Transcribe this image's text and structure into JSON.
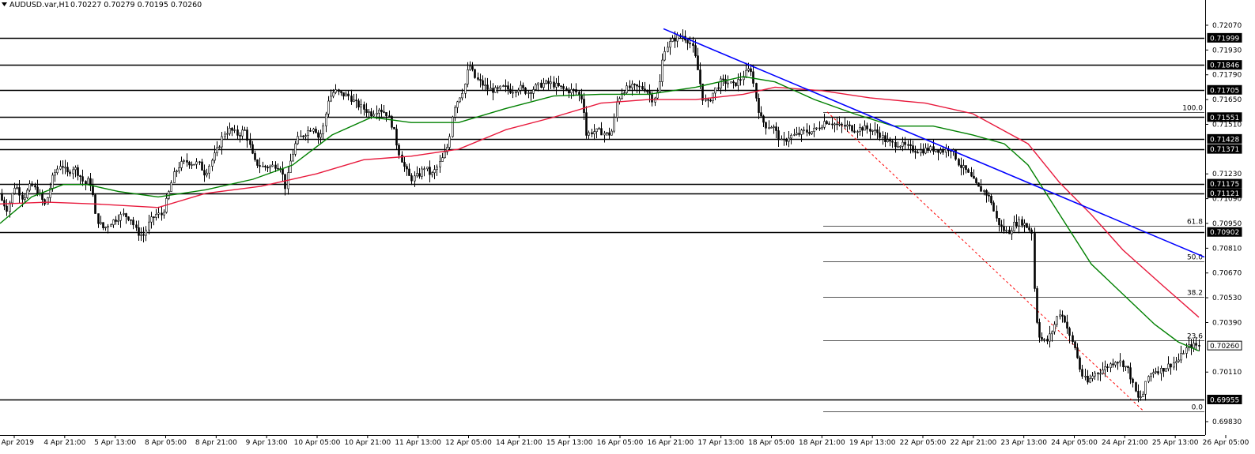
{
  "header": {
    "symbol_text": "AUDUSD.var,H1",
    "ohlc_text": "0.70227 0.70279 0.70195 0.70260"
  },
  "colors": {
    "background": "#ffffff",
    "axis": "#000000",
    "candle_bull": "#ffffff",
    "candle_bear": "#000000",
    "ma_fast": "#008000",
    "ma_slow": "#e8193c",
    "trendline": "#0000ff",
    "fib_level": "#555555",
    "fib_diagonal": "#ff0000",
    "sr_line": "#000000"
  },
  "chart_data": {
    "type": "candlestick",
    "y_range": [
      0.6983,
      0.7211
    ],
    "price_ticks": [
      "0.72070",
      "0.71930",
      "0.71790",
      "0.71650",
      "0.71510",
      "0.71230",
      "0.71090",
      "0.70950",
      "0.70810",
      "0.70670",
      "0.70530",
      "0.70390",
      "0.70110",
      "0.69830"
    ],
    "highlighted_prices": [
      "0.71999",
      "0.71846",
      "0.71705",
      "0.71551",
      "0.71428",
      "0.71371",
      "0.71175",
      "0.71121",
      "0.70902",
      "0.70260",
      "0.69955"
    ],
    "current_price": "0.70260",
    "time_ticks": [
      "4 Apr 2019",
      "4 Apr 21:00",
      "5 Apr 13:00",
      "8 Apr 05:00",
      "8 Apr 21:00",
      "9 Apr 13:00",
      "10 Apr 05:00",
      "10 Apr 21:00",
      "11 Apr 13:00",
      "12 Apr 05:00",
      "14 Apr 21:00",
      "15 Apr 13:00",
      "16 Apr 05:00",
      "16 Apr 21:00",
      "17 Apr 13:00",
      "18 Apr 05:00",
      "18 Apr 21:00",
      "19 Apr 13:00",
      "22 Apr 05:00",
      "22 Apr 21:00",
      "23 Apr 13:00",
      "24 Apr 05:00",
      "24 Apr 21:00",
      "25 Apr 13:00",
      "26 Apr 05:00"
    ],
    "support_resistance": [
      0.71999,
      0.71846,
      0.71705,
      0.71551,
      0.71428,
      0.71371,
      0.71175,
      0.71121,
      0.70902,
      0.69955
    ],
    "fibonacci": {
      "high": 0.7158,
      "low": 0.6989,
      "levels": [
        {
          "label": "100.0",
          "ratio": 1.0
        },
        {
          "label": "61.8",
          "ratio": 0.618
        },
        {
          "label": "50.0",
          "ratio": 0.5
        },
        {
          "label": "38.2",
          "ratio": 0.382
        },
        {
          "label": "23.6",
          "ratio": 0.236
        },
        {
          "label": "0.0",
          "ratio": 0.0
        }
      ]
    },
    "trendline": {
      "from": 0.7205,
      "to": 0.7076
    },
    "price_path": [
      [
        0,
        0.7112
      ],
      [
        12,
        0.7103
      ],
      [
        22,
        0.7117
      ],
      [
        32,
        0.7109
      ],
      [
        42,
        0.7117
      ],
      [
        52,
        0.7112
      ],
      [
        60,
        0.7105
      ],
      [
        70,
        0.7122
      ],
      [
        80,
        0.7129
      ],
      [
        88,
        0.7123
      ],
      [
        96,
        0.7127
      ],
      [
        104,
        0.7122
      ],
      [
        110,
        0.7117
      ],
      [
        116,
        0.712
      ],
      [
        120,
        0.7112
      ],
      [
        124,
        0.7098
      ],
      [
        134,
        0.7092
      ],
      [
        144,
        0.7096
      ],
      [
        158,
        0.71
      ],
      [
        168,
        0.7098
      ],
      [
        176,
        0.709
      ],
      [
        184,
        0.7088
      ],
      [
        192,
        0.7096
      ],
      [
        200,
        0.71
      ],
      [
        208,
        0.71
      ],
      [
        215,
        0.711
      ],
      [
        222,
        0.7122
      ],
      [
        230,
        0.7128
      ],
      [
        238,
        0.713
      ],
      [
        246,
        0.7129
      ],
      [
        254,
        0.7129
      ],
      [
        262,
        0.7123
      ],
      [
        270,
        0.713
      ],
      [
        278,
        0.7137
      ],
      [
        286,
        0.7146
      ],
      [
        294,
        0.7148
      ],
      [
        304,
        0.7145
      ],
      [
        312,
        0.7148
      ],
      [
        318,
        0.714
      ],
      [
        324,
        0.713
      ],
      [
        334,
        0.7127
      ],
      [
        344,
        0.7127
      ],
      [
        352,
        0.7128
      ],
      [
        358,
        0.7127
      ],
      [
        364,
        0.7115
      ],
      [
        370,
        0.713
      ],
      [
        378,
        0.7142
      ],
      [
        386,
        0.7145
      ],
      [
        394,
        0.7148
      ],
      [
        400,
        0.715
      ],
      [
        406,
        0.7143
      ],
      [
        412,
        0.715
      ],
      [
        418,
        0.7165
      ],
      [
        426,
        0.717
      ],
      [
        434,
        0.7168
      ],
      [
        444,
        0.7167
      ],
      [
        452,
        0.7163
      ],
      [
        462,
        0.716
      ],
      [
        472,
        0.7157
      ],
      [
        482,
        0.716
      ],
      [
        492,
        0.7157
      ],
      [
        500,
        0.7149
      ],
      [
        506,
        0.7137
      ],
      [
        514,
        0.7127
      ],
      [
        522,
        0.712
      ],
      [
        532,
        0.7122
      ],
      [
        540,
        0.7127
      ],
      [
        548,
        0.7122
      ],
      [
        556,
        0.7127
      ],
      [
        564,
        0.7133
      ],
      [
        570,
        0.714
      ],
      [
        576,
        0.716
      ],
      [
        582,
        0.7165
      ],
      [
        590,
        0.7172
      ],
      [
        596,
        0.7185
      ],
      [
        604,
        0.7177
      ],
      [
        612,
        0.7174
      ],
      [
        620,
        0.7171
      ],
      [
        630,
        0.717
      ],
      [
        640,
        0.7172
      ],
      [
        650,
        0.717
      ],
      [
        660,
        0.7172
      ],
      [
        670,
        0.7169
      ],
      [
        680,
        0.7172
      ],
      [
        690,
        0.7174
      ],
      [
        700,
        0.7174
      ],
      [
        710,
        0.7172
      ],
      [
        720,
        0.717
      ],
      [
        730,
        0.717
      ],
      [
        740,
        0.7165
      ],
      [
        744,
        0.7145
      ],
      [
        752,
        0.7147
      ],
      [
        762,
        0.7147
      ],
      [
        772,
        0.7145
      ],
      [
        778,
        0.7148
      ],
      [
        782,
        0.7163
      ],
      [
        790,
        0.717
      ],
      [
        800,
        0.7172
      ],
      [
        810,
        0.7172
      ],
      [
        820,
        0.7171
      ],
      [
        828,
        0.7165
      ],
      [
        836,
        0.717
      ],
      [
        842,
        0.7193
      ],
      [
        850,
        0.7197
      ],
      [
        858,
        0.72
      ],
      [
        866,
        0.7201
      ],
      [
        874,
        0.7198
      ],
      [
        880,
        0.7193
      ],
      [
        886,
        0.718
      ],
      [
        892,
        0.7165
      ],
      [
        898,
        0.7163
      ],
      [
        906,
        0.717
      ],
      [
        914,
        0.7175
      ],
      [
        922,
        0.7175
      ],
      [
        930,
        0.7173
      ],
      [
        938,
        0.7176
      ],
      [
        946,
        0.718
      ],
      [
        952,
        0.7183
      ],
      [
        958,
        0.7168
      ],
      [
        964,
        0.7155
      ],
      [
        972,
        0.715
      ],
      [
        980,
        0.715
      ],
      [
        986,
        0.7145
      ],
      [
        992,
        0.714
      ],
      [
        1000,
        0.7144
      ],
      [
        1010,
        0.7145
      ],
      [
        1020,
        0.7147
      ],
      [
        1030,
        0.7147
      ],
      [
        1040,
        0.715
      ],
      [
        1046,
        0.7153
      ],
      [
        1054,
        0.7152
      ],
      [
        1064,
        0.715
      ],
      [
        1074,
        0.715
      ],
      [
        1084,
        0.7148
      ],
      [
        1094,
        0.7149
      ],
      [
        1104,
        0.7148
      ],
      [
        1114,
        0.7146
      ],
      [
        1122,
        0.7142
      ],
      [
        1130,
        0.714
      ],
      [
        1138,
        0.714
      ],
      [
        1146,
        0.7139
      ],
      [
        1156,
        0.7137
      ],
      [
        1166,
        0.7136
      ],
      [
        1176,
        0.7137
      ],
      [
        1186,
        0.7137
      ],
      [
        1196,
        0.7136
      ],
      [
        1204,
        0.7138
      ],
      [
        1210,
        0.7134
      ],
      [
        1216,
        0.7128
      ],
      [
        1224,
        0.7125
      ],
      [
        1232,
        0.712
      ],
      [
        1240,
        0.7115
      ],
      [
        1248,
        0.7113
      ],
      [
        1256,
        0.7108
      ],
      [
        1262,
        0.7098
      ],
      [
        1270,
        0.7092
      ],
      [
        1278,
        0.709
      ],
      [
        1286,
        0.7095
      ],
      [
        1294,
        0.7096
      ],
      [
        1302,
        0.7093
      ],
      [
        1308,
        0.709
      ],
      [
        1312,
        0.7045
      ],
      [
        1318,
        0.703
      ],
      [
        1326,
        0.7028
      ],
      [
        1334,
        0.7035
      ],
      [
        1342,
        0.7045
      ],
      [
        1350,
        0.704
      ],
      [
        1356,
        0.703
      ],
      [
        1362,
        0.7025
      ],
      [
        1370,
        0.701
      ],
      [
        1378,
        0.7005
      ],
      [
        1386,
        0.701
      ],
      [
        1396,
        0.7012
      ],
      [
        1406,
        0.7015
      ],
      [
        1414,
        0.7018
      ],
      [
        1422,
        0.7016
      ],
      [
        1430,
        0.7012
      ],
      [
        1436,
        0.7003
      ],
      [
        1442,
        0.6996
      ],
      [
        1448,
        0.6998
      ],
      [
        1454,
        0.7008
      ],
      [
        1462,
        0.7012
      ],
      [
        1470,
        0.7012
      ],
      [
        1478,
        0.7014
      ],
      [
        1486,
        0.7016
      ],
      [
        1494,
        0.7018
      ],
      [
        1500,
        0.7023
      ],
      [
        1508,
        0.7026
      ],
      [
        1516,
        0.7026
      ]
    ],
    "ma_fast_path": [
      [
        0,
        0.7095
      ],
      [
        40,
        0.711
      ],
      [
        80,
        0.7117
      ],
      [
        110,
        0.7117
      ],
      [
        150,
        0.7113
      ],
      [
        200,
        0.711
      ],
      [
        260,
        0.7114
      ],
      [
        320,
        0.712
      ],
      [
        370,
        0.7128
      ],
      [
        420,
        0.7145
      ],
      [
        470,
        0.7155
      ],
      [
        520,
        0.7152
      ],
      [
        580,
        0.7152
      ],
      [
        640,
        0.716
      ],
      [
        700,
        0.7167
      ],
      [
        760,
        0.7168
      ],
      [
        820,
        0.7168
      ],
      [
        880,
        0.7172
      ],
      [
        940,
        0.7178
      ],
      [
        980,
        0.7175
      ],
      [
        1030,
        0.7165
      ],
      [
        1080,
        0.7157
      ],
      [
        1130,
        0.715
      ],
      [
        1180,
        0.715
      ],
      [
        1230,
        0.7145
      ],
      [
        1270,
        0.714
      ],
      [
        1300,
        0.7128
      ],
      [
        1340,
        0.71
      ],
      [
        1380,
        0.7072
      ],
      [
        1420,
        0.7055
      ],
      [
        1460,
        0.7038
      ],
      [
        1490,
        0.7028
      ],
      [
        1516,
        0.7023
      ]
    ],
    "ma_slow_path": [
      [
        0,
        0.7106
      ],
      [
        60,
        0.7107
      ],
      [
        120,
        0.7106
      ],
      [
        200,
        0.7104
      ],
      [
        260,
        0.7112
      ],
      [
        330,
        0.7116
      ],
      [
        400,
        0.7123
      ],
      [
        460,
        0.7131
      ],
      [
        520,
        0.7133
      ],
      [
        580,
        0.7137
      ],
      [
        640,
        0.7148
      ],
      [
        700,
        0.7155
      ],
      [
        760,
        0.7163
      ],
      [
        820,
        0.7165
      ],
      [
        880,
        0.7165
      ],
      [
        940,
        0.7168
      ],
      [
        980,
        0.7172
      ],
      [
        1040,
        0.717
      ],
      [
        1100,
        0.7166
      ],
      [
        1170,
        0.7163
      ],
      [
        1230,
        0.7157
      ],
      [
        1300,
        0.714
      ],
      [
        1340,
        0.7118
      ],
      [
        1380,
        0.71
      ],
      [
        1420,
        0.708
      ],
      [
        1470,
        0.706
      ],
      [
        1516,
        0.7042
      ]
    ]
  }
}
